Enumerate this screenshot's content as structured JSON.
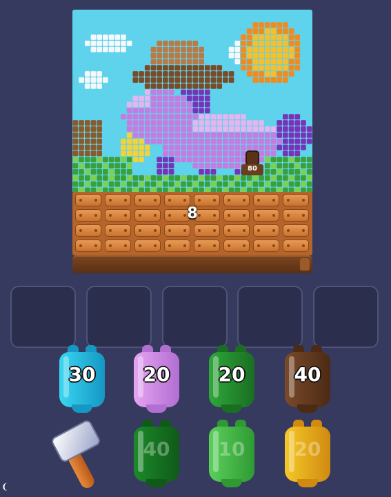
{
  "board": {
    "palette": {
      "sky": "#5fd2ec",
      "cloud": "#f4f8fb",
      "sun": "#f7c02a",
      "sun_edge": "#f38a1c",
      "hat": "#b97a45",
      "hat_dark": "#7b4a26",
      "unicorn": "#c77be0",
      "unicorn_light": "#e6b4ee",
      "unicorn_dark": "#7a33b8",
      "mane_yellow": "#f3d23a",
      "grass": "#3aa03a",
      "grass_light": "#7fd04a",
      "dirt": "#8b5a2b"
    },
    "bucket_marker": {
      "icon": "small-barrel-icon",
      "count": "80"
    }
  },
  "crate_stack": {
    "count": "8",
    "crate_color": "#d88540"
  },
  "conveyor": {
    "color": "#6a3a1a"
  },
  "slots": [
    {
      "state": "empty"
    },
    {
      "state": "empty"
    },
    {
      "state": "empty"
    },
    {
      "state": "empty"
    },
    {
      "state": "empty"
    }
  ],
  "barrels": {
    "row1": [
      {
        "label": "30",
        "color": "#39d7f2",
        "dark": "#1697c4",
        "locked": false
      },
      {
        "label": "20",
        "color": "#e6a4f2",
        "dark": "#b26ed1",
        "locked": false
      },
      {
        "label": "20",
        "color": "#2fa83a",
        "dark": "#1a6e22",
        "locked": false
      },
      {
        "label": "40",
        "color": "#7a4a2a",
        "dark": "#4c2a14",
        "locked": false
      }
    ],
    "row2": [
      {
        "label": "40",
        "color": "#1c8a2a",
        "dark": "#0f5a18",
        "locked": true
      },
      {
        "label": "10",
        "color": "#5ad05a",
        "dark": "#2f9a34",
        "locked": true
      },
      {
        "label": "20",
        "color": "#f5c928",
        "dark": "#d08a10",
        "locked": true
      }
    ]
  },
  "tools": {
    "hammer": {
      "icon": "hammer-icon"
    }
  },
  "corner_mark": "❨"
}
